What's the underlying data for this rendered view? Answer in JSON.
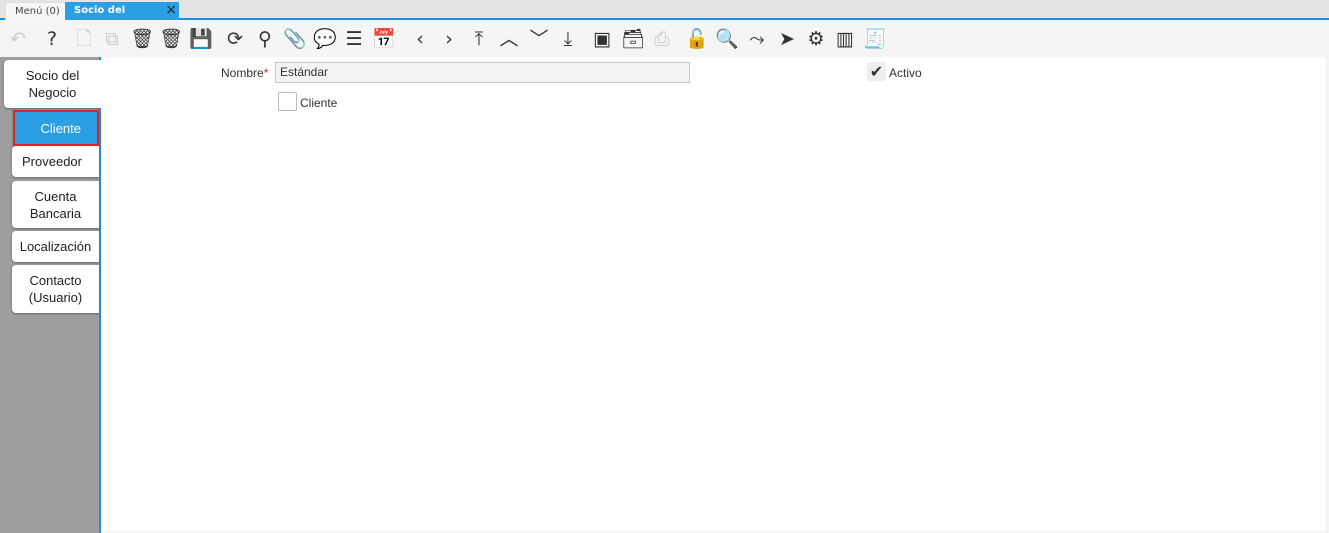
{
  "tabs": {
    "menu": "Menú (0)",
    "active": "Socio del Negocio",
    "close_icon": "×"
  },
  "toolbar": [
    {
      "name": "undo",
      "glyph": "↶",
      "disabled": true
    },
    {
      "name": "help",
      "glyph": "?",
      "disabled": false
    },
    {
      "name": "new-record",
      "glyph": "🗋",
      "disabled": true
    },
    {
      "name": "copy-record",
      "glyph": "⧉",
      "disabled": true
    },
    {
      "name": "delete",
      "glyph": "🗑",
      "disabled": false
    },
    {
      "name": "delete-selection",
      "glyph": "🗑",
      "disabled": false
    },
    {
      "name": "save",
      "glyph": "💾",
      "disabled": true
    },
    {
      "name": "refresh",
      "glyph": "⟳",
      "disabled": false
    },
    {
      "name": "find",
      "glyph": "⚲",
      "disabled": false
    },
    {
      "name": "attachment",
      "glyph": "📎",
      "disabled": false
    },
    {
      "name": "chat",
      "glyph": "💬",
      "disabled": false
    },
    {
      "name": "grid-toggle",
      "glyph": "☰",
      "disabled": false
    },
    {
      "name": "calendar",
      "glyph": "📅",
      "disabled": true
    },
    {
      "name": "previous",
      "glyph": "‹",
      "disabled": false
    },
    {
      "name": "next",
      "glyph": "›",
      "disabled": false
    },
    {
      "name": "first",
      "glyph": "⤒",
      "disabled": false
    },
    {
      "name": "parent",
      "glyph": "︿",
      "disabled": false
    },
    {
      "name": "detail",
      "glyph": "﹀",
      "disabled": false
    },
    {
      "name": "last",
      "glyph": "⤓",
      "disabled": false
    },
    {
      "name": "report",
      "glyph": "▣",
      "disabled": false
    },
    {
      "name": "archive",
      "glyph": "🗃",
      "disabled": false
    },
    {
      "name": "print",
      "glyph": "⎙",
      "disabled": true
    },
    {
      "name": "lock",
      "glyph": "🔓",
      "disabled": false
    },
    {
      "name": "zoom-across",
      "glyph": "🔍",
      "disabled": false
    },
    {
      "name": "workflow",
      "glyph": "⤳",
      "disabled": false
    },
    {
      "name": "request",
      "glyph": "➤",
      "disabled": false
    },
    {
      "name": "process",
      "glyph": "⚙",
      "disabled": false
    },
    {
      "name": "product-info",
      "glyph": "▥",
      "disabled": false
    },
    {
      "name": "post-document",
      "glyph": "🧾",
      "disabled": false
    }
  ],
  "side_tabs": [
    "Socio del\nNegocio",
    "Cliente",
    "Proveedor",
    "Cuenta\nBancaria",
    "Localización",
    "Contacto\n(Usuario)"
  ],
  "form": {
    "nombre_label": "Nombre",
    "required_mark": "*",
    "nombre_value": "Estándar",
    "cliente_label": "Cliente",
    "cliente_checked": false,
    "activo_label": "Activo",
    "activo_checked": true,
    "check_glyph": "✔"
  }
}
